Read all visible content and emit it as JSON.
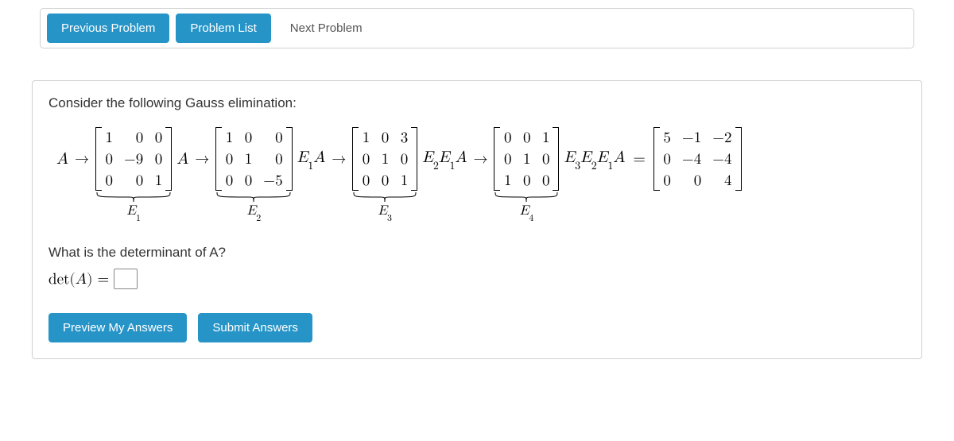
{
  "nav": {
    "prev": "Previous Problem",
    "list": "Problem List",
    "next": "Next Problem"
  },
  "prompt": "Consider the following Gauss elimination:",
  "steps": [
    {
      "lhs": "A",
      "arrow": "→",
      "matrix": [
        [
          "1",
          "0",
          "0"
        ],
        [
          "0",
          "−9",
          "0"
        ],
        [
          "0",
          "0",
          "1"
        ]
      ],
      "underlabel": "E",
      "undersub": "1"
    },
    {
      "lhs": "A",
      "arrow": "→",
      "matrix": [
        [
          "1",
          "0",
          "0"
        ],
        [
          "0",
          "1",
          "0"
        ],
        [
          "0",
          "0",
          "−5"
        ]
      ],
      "underlabel": "E",
      "undersub": "2"
    },
    {
      "lhs_html": "E₁A",
      "lhs_parts": [
        {
          "t": "E",
          "s": "1"
        },
        {
          "t": "A"
        }
      ],
      "arrow": "→",
      "matrix": [
        [
          "1",
          "0",
          "3"
        ],
        [
          "0",
          "1",
          "0"
        ],
        [
          "0",
          "0",
          "1"
        ]
      ],
      "underlabel": "E",
      "undersub": "3"
    },
    {
      "lhs_parts": [
        {
          "t": "E",
          "s": "2"
        },
        {
          "t": "E",
          "s": "1"
        },
        {
          "t": "A"
        }
      ],
      "arrow": "→",
      "matrix": [
        [
          "0",
          "0",
          "1"
        ],
        [
          "0",
          "1",
          "0"
        ],
        [
          "1",
          "0",
          "0"
        ]
      ],
      "underlabel": "E",
      "undersub": "4"
    },
    {
      "lhs_parts": [
        {
          "t": "E",
          "s": "3"
        },
        {
          "t": "E",
          "s": "2"
        },
        {
          "t": "E",
          "s": "1"
        },
        {
          "t": "A"
        }
      ],
      "eq": "=",
      "matrix": [
        [
          "5",
          "−1",
          "−2"
        ],
        [
          "0",
          "−4",
          "−4"
        ],
        [
          "0",
          "0",
          "4"
        ]
      ]
    }
  ],
  "question": "What is the determinant of A?",
  "det_label_pre": "det(",
  "det_label_var": "A",
  "det_label_post": ")",
  "det_eq": "=",
  "actions": {
    "preview": "Preview My Answers",
    "submit": "Submit Answers"
  }
}
